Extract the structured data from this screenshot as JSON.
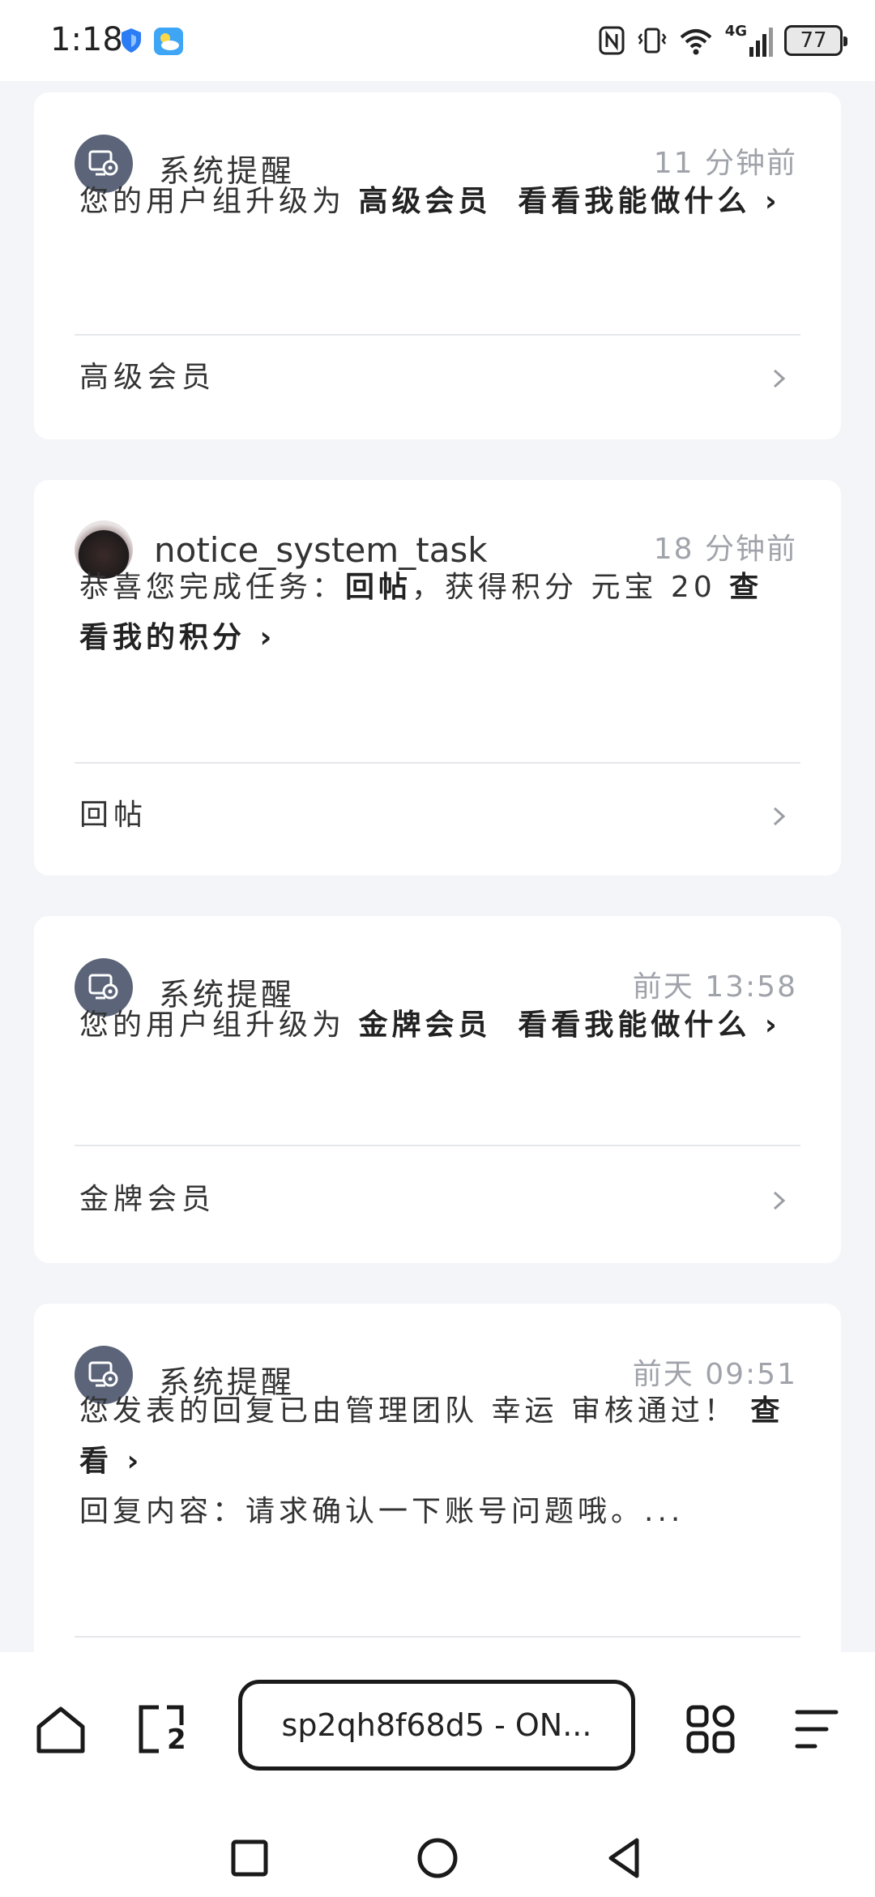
{
  "status_bar": {
    "time": "1:18",
    "battery": "77",
    "network": "4G"
  },
  "notifications": [
    {
      "sender": "系统提醒",
      "time": "11 分钟前",
      "message_prefix": "您的用户组升级为 ",
      "message_bold": "高级会员",
      "message_mid": "",
      "message_link": "看看我能做什么",
      "link_row": "高级会员"
    },
    {
      "sender": "notice_system_task",
      "time": "18 分钟前",
      "message_prefix": "恭喜您完成任务：",
      "message_bold": "回帖",
      "message_mid": "，获得积分 元宝 20 ",
      "message_link": "查看我的积分",
      "link_row": "回帖"
    },
    {
      "sender": "系统提醒",
      "time": "前天 13:58",
      "message_prefix": "您的用户组升级为 ",
      "message_bold": "金牌会员",
      "message_mid": "",
      "message_link": "看看我能做什么",
      "link_row": "金牌会员"
    },
    {
      "sender": "系统提醒",
      "time": "前天 09:51",
      "message_prefix": "您发表的回复已由管理团队 幸运 审核通过！",
      "message_bold": "",
      "message_mid": "",
      "message_link": "查看",
      "message_line2": "回复内容：请求确认一下账号问题哦。...",
      "link_row": ""
    }
  ],
  "bottom_bar": {
    "url_title": "sp2qh8f68d5 - ON...",
    "tab_count": "2"
  },
  "colors": {
    "page_bg": "#f4f5f9",
    "card_bg": "#ffffff",
    "avatar_bg": "#5b6478",
    "muted_text": "#a0a3aa"
  }
}
